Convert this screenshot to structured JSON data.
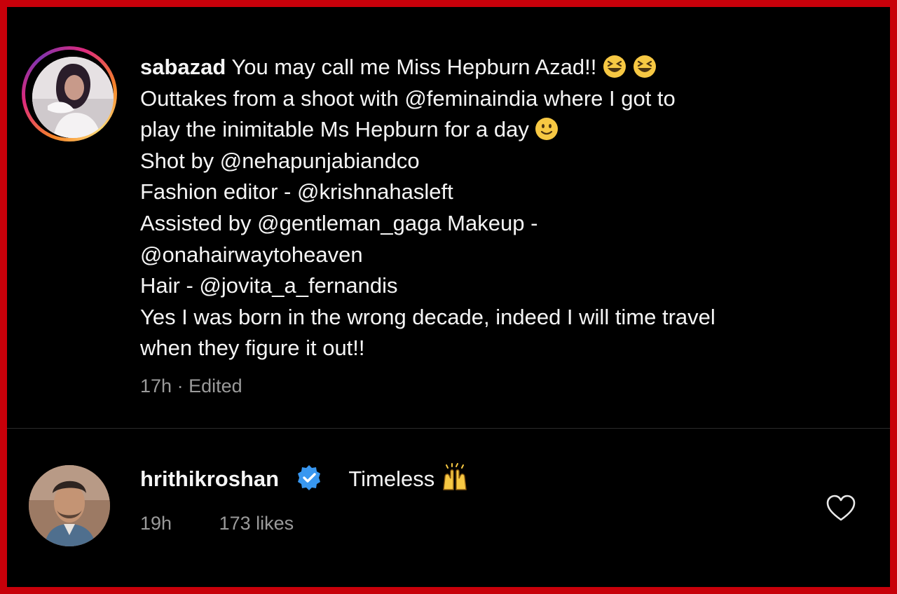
{
  "caption": {
    "username": "sabazad",
    "lines": [
      "You may call me Miss Hepburn Azad!!",
      "Outtakes from a shoot with @feminaindia where I got to",
      "play the inimitable Ms Hepburn for a day",
      "Shot by @nehapunjabiandco",
      "Fashion editor - @krishnahasleft",
      "Assisted by @gentleman_gaga Makeup -",
      "@onahairwaytoheaven",
      "Hair - @jovita_a_fernandis",
      "Yes I was born in the wrong decade, indeed I will time travel",
      "when they figure it out!!"
    ],
    "time": "17h",
    "separator": "·",
    "edited": "Edited",
    "emojis": [
      "grinning-squinting-face-icon",
      "grinning-squinting-face-icon",
      "slightly-smiling-face-icon"
    ]
  },
  "comment": {
    "username": "hrithikroshan",
    "verified": true,
    "text": "Timeless",
    "emoji": "raising-hands-icon",
    "time": "19h",
    "likes": "173 likes",
    "like_icon": "heart-outline-icon"
  },
  "colors": {
    "border": "#c8000a",
    "background": "#000000",
    "text": "#f5f5f5",
    "muted": "#9a9a9a",
    "verified": "#3897f0",
    "emoji": "#f7c843"
  }
}
